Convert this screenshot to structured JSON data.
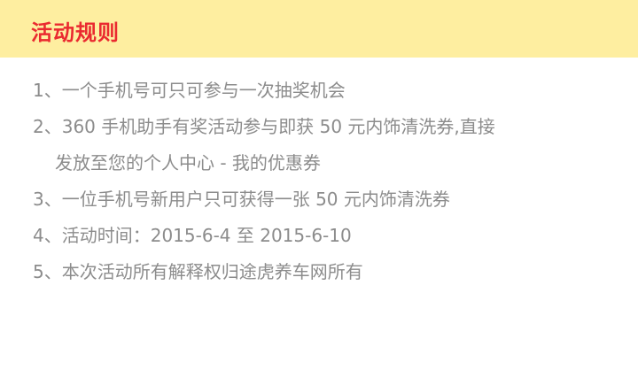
{
  "header": {
    "title": "活动规则"
  },
  "rules": [
    "1、一个手机号可只可参与一次抽奖机会",
    "2、360 手机助手有奖活动参与即获 50 元内饰清洗券,直接",
    "发放至您的个人中心 - 我的优惠券",
    "3、一位手机号新用户只可获得一张 50 元内饰清洗券",
    "4、活动时间：2015-6-4 至 2015-6-10",
    "5、本次活动所有解释权归途虎养车网所有"
  ],
  "colors": {
    "header_bg": "#feeea0",
    "title": "#ea2a30",
    "text": "#8c8c8c"
  }
}
